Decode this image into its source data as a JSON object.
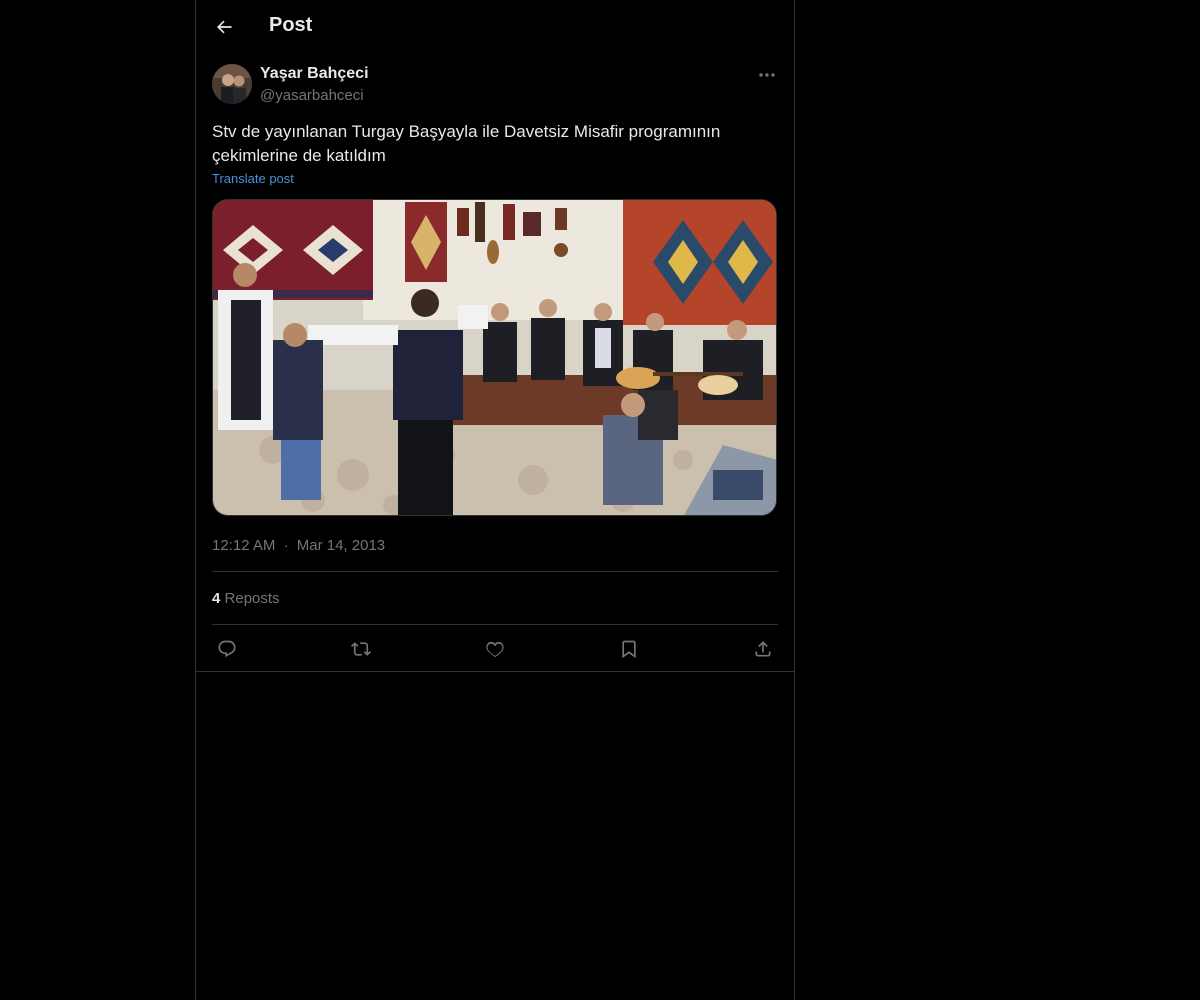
{
  "header": {
    "title": "Post"
  },
  "author": {
    "name": "Yaşar Bahçeci",
    "handle": "@yasarbahceci"
  },
  "post": {
    "text": "Stv de yayınlanan Turgay Başyayla ile Davetsiz Misafir programının çekimlerine de katıldım",
    "translate_label": "Translate post",
    "time": "12:12 AM",
    "separator": "·",
    "date": "Mar 14, 2013",
    "reposts_count": "4",
    "reposts_label": "Reposts"
  },
  "icons": {
    "back": "arrow-left-icon",
    "more": "more-horizontal-icon",
    "reply": "reply-icon",
    "repost": "repost-icon",
    "like": "heart-icon",
    "bookmark": "bookmark-icon",
    "share": "share-icon"
  },
  "colors": {
    "background": "#000000",
    "border": "#2f3336",
    "text_primary": "#e7e9ea",
    "text_secondary": "#71767b",
    "link": "#4a8fd6"
  }
}
